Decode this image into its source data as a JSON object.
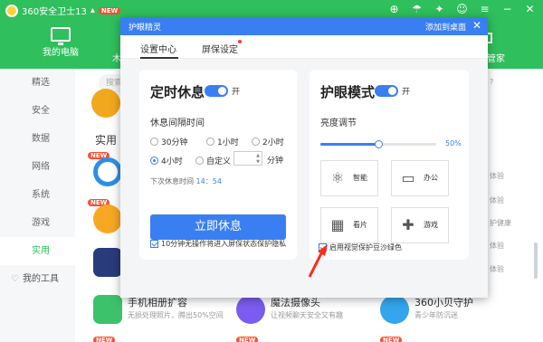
{
  "app": {
    "title": "360安全卫士13",
    "title_badge": "NEW",
    "nav_current": "我的电脑",
    "nav_partial_left": "木",
    "nav_partial_right": "管家"
  },
  "sidebar": {
    "items": [
      {
        "label": "精选",
        "active": false
      },
      {
        "label": "安全",
        "active": false
      },
      {
        "label": "数据",
        "active": false
      },
      {
        "label": "网络",
        "active": false
      },
      {
        "label": "系统",
        "active": false
      },
      {
        "label": "游戏",
        "active": false
      },
      {
        "label": "实用",
        "active": true
      }
    ],
    "tools_label": "我的工具"
  },
  "content": {
    "search_placeholder": "搜索",
    "section_title": "实用",
    "badge_new": "NEW",
    "bottom_apps": [
      {
        "title": "手机相册扩容",
        "desc": "无损处理照片，腾出50%空间"
      },
      {
        "title": "魔法摄像头",
        "desc": "让视频聊天安全又有趣"
      },
      {
        "title": "360小贝守护",
        "desc": "青少年防沉迷"
      }
    ],
    "right_fragments": [
      "?",
      "体验",
      "体验",
      "护健康",
      "体验",
      "体验"
    ]
  },
  "dialog": {
    "title": "护眼精灵",
    "add_to_desktop": "添加到桌面",
    "close": "✕",
    "tabs": [
      {
        "label": "设置中心",
        "active": true
      },
      {
        "label": "屏保设定",
        "active": false,
        "dot": true
      }
    ],
    "rest": {
      "heading": "定时休息",
      "toggle_label": "开",
      "interval_label": "休息间隔时间",
      "options": [
        {
          "label": "30分钟",
          "checked": false
        },
        {
          "label": "1小时",
          "checked": false
        },
        {
          "label": "2小时",
          "checked": false
        },
        {
          "label": "4小时",
          "checked": true
        },
        {
          "label": "自定义",
          "checked": false
        }
      ],
      "custom_value": "",
      "custom_unit": "分钟",
      "next_rest_label": "下次休息时间",
      "next_rest_time": "14：54",
      "rest_now_button": "立即休息",
      "screensaver_checkbox": "10分钟无操作将进入屏保状态保护隐私",
      "screensaver_checked": true
    },
    "eye": {
      "heading": "护眼模式",
      "toggle_label": "开",
      "brightness_label": "亮度调节",
      "brightness_value": "50%",
      "brightness_fraction": 0.5,
      "modes": [
        {
          "label": "智能",
          "icon": "atom-icon"
        },
        {
          "label": "办公",
          "icon": "monitor-icon"
        },
        {
          "label": "看片",
          "icon": "film-icon"
        },
        {
          "label": "游戏",
          "icon": "gamepad-icon"
        }
      ],
      "green_checkbox": "启用视觉保护豆沙绿色",
      "green_checked": true
    }
  },
  "colors": {
    "green": "#2fbf5c",
    "blue": "#3a7ff2",
    "red": "#ff3b30"
  }
}
